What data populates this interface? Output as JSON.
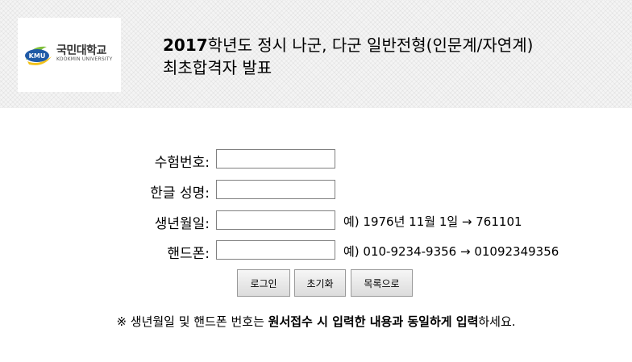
{
  "logo": {
    "emblem_text": "KMU",
    "name_kr": "국민대학교",
    "name_en": "KOOKMIN UNIVERSITY"
  },
  "title": {
    "line1_year": "2017",
    "line1_rest": "학년도 정시 나군, 다군 일반전형(인문계/자연계)",
    "line2": "최초합격자 발표"
  },
  "form": {
    "exam_number": {
      "label": "수험번호:",
      "value": ""
    },
    "korean_name": {
      "label": "한글 성명:",
      "value": ""
    },
    "birth_date": {
      "label": "생년월일:",
      "value": "",
      "hint": "예) 1976년 11월 1일 → 761101"
    },
    "phone": {
      "label": "핸드폰:",
      "value": "",
      "hint": "예) 010-9234-9356 → 01092349356"
    }
  },
  "buttons": {
    "login": "로그인",
    "reset": "초기화",
    "list": "목록으로"
  },
  "notice": {
    "prefix": "※ 생년월일 및 핸드폰 번호는 ",
    "bold": "원서접수 시 입력한 내용과 동일하게 입력",
    "suffix": "하세요."
  },
  "colors": {
    "logo_blue": "#1f5aa6",
    "logo_green": "#7fbf3a",
    "logo_yellow": "#f2c21b"
  }
}
